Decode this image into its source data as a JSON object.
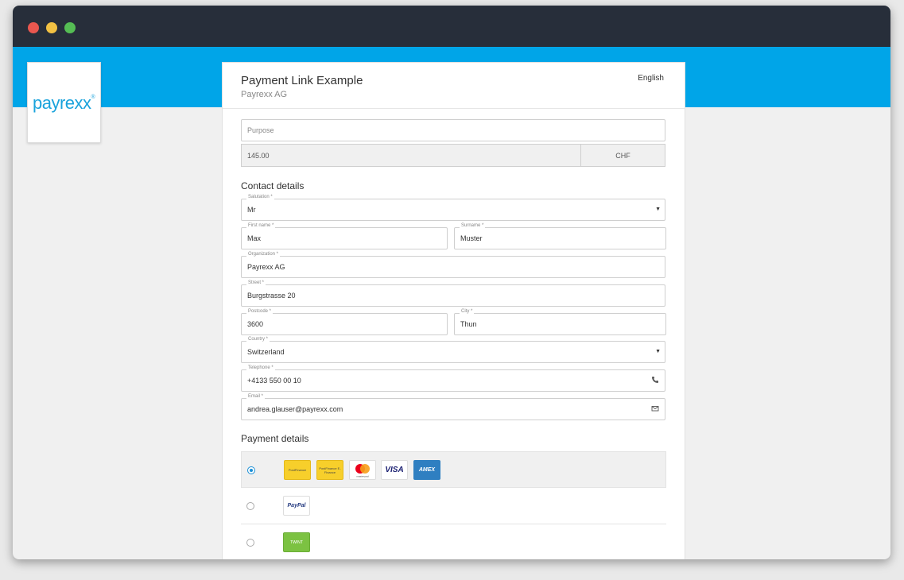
{
  "logo": {
    "text": "payrexx",
    "mark": "®"
  },
  "header": {
    "title": "Payment Link Example",
    "subtitle": "Payrexx AG",
    "language": "English"
  },
  "purpose": {
    "placeholder": "Purpose"
  },
  "amount": {
    "value": "145.00",
    "currency": "CHF"
  },
  "contact": {
    "title": "Contact details",
    "salutation": {
      "label": "Salutation *",
      "value": "Mr"
    },
    "first_name": {
      "label": "First name *",
      "value": "Max"
    },
    "surname": {
      "label": "Surname *",
      "value": "Muster"
    },
    "organization": {
      "label": "Organization *",
      "value": "Payrexx AG"
    },
    "street": {
      "label": "Street *",
      "value": "Burgstrasse 20"
    },
    "postcode": {
      "label": "Postcode *",
      "value": "3600"
    },
    "city": {
      "label": "City *",
      "value": "Thun"
    },
    "country": {
      "label": "Country *",
      "value": "Switzerland"
    },
    "telephone": {
      "label": "Telephone *",
      "value": "+4133 550 00 10"
    },
    "email": {
      "label": "Email *",
      "value": "andrea.glauser@payrexx.com"
    }
  },
  "payment": {
    "title": "Payment details",
    "methods": {
      "postfinance": "PostFinance",
      "postfinance_efinance": "PostFinance E-Finance",
      "mastercard": "mastercard",
      "visa": "VISA",
      "amex": "AMEX",
      "paypal": "PayPal",
      "twint": "TWINT"
    }
  },
  "colors": {
    "titlebar": "#272e3a",
    "hero": "#00a5e8",
    "accent": "#1a8fd6"
  }
}
